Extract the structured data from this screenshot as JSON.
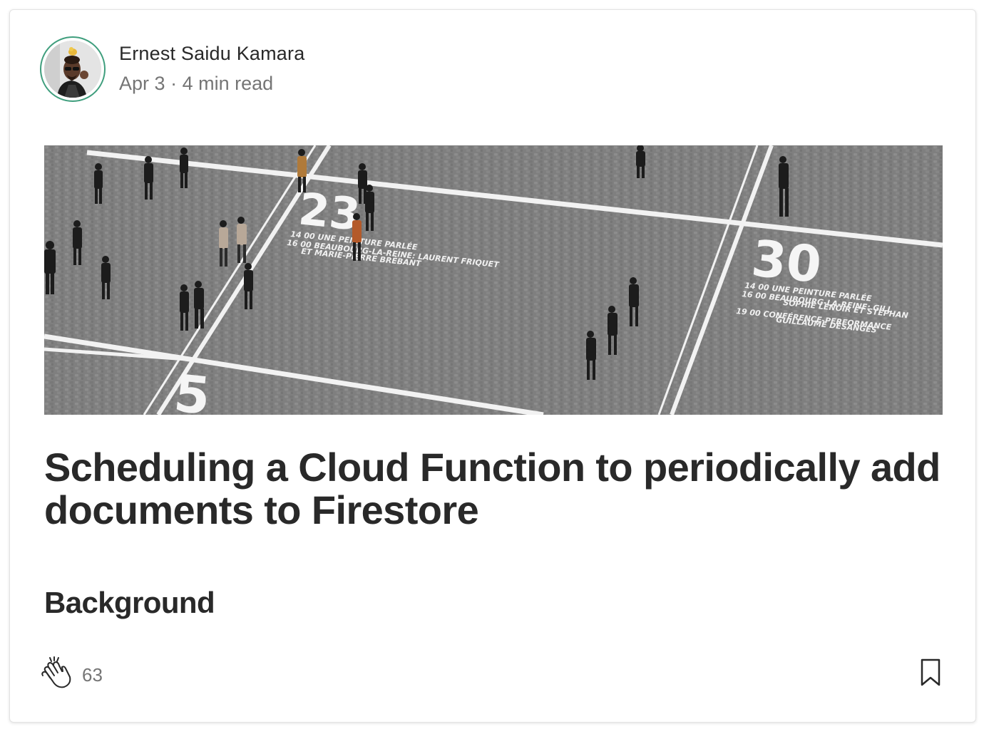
{
  "author": {
    "name": "Ernest Saidu Kamara",
    "avatar_icon": "author-avatar-photo"
  },
  "meta": {
    "date": "Apr 3",
    "separator": "·",
    "read_time": "4 min read"
  },
  "hero_image": {
    "description_icon": "hero-photo",
    "signage": {
      "number_left": "23",
      "number_right": "30",
      "number_bottom": "5",
      "left_lines": [
        "14 00  UNE PEINTURE PARLÉE",
        "16 00  BEAUBOURG-LA-REINE: LAURENT FRIQUET",
        "ET MARIE-PIERRE BRÉBANT"
      ],
      "right_lines": [
        "14 00  UNE PEINTURE PARLÉE",
        "16 00  BEAUBOURG-LA-REINE: GILL",
        "SOPHIE LENOIR ET STÉPHAN",
        "19 00  CONFÉRENCE-PERFORMANCE",
        "GUILLAUME DÉSANGES"
      ]
    }
  },
  "article": {
    "title": "Scheduling a Cloud Function to periodically add documents to Firestore",
    "subtitle": "Background"
  },
  "actions": {
    "clap_icon": "clap-icon",
    "clap_count": "63",
    "bookmark_icon": "bookmark-icon"
  },
  "colors": {
    "text_primary": "#292929",
    "text_secondary": "#757575",
    "avatar_ring": "#3f9e7d"
  }
}
